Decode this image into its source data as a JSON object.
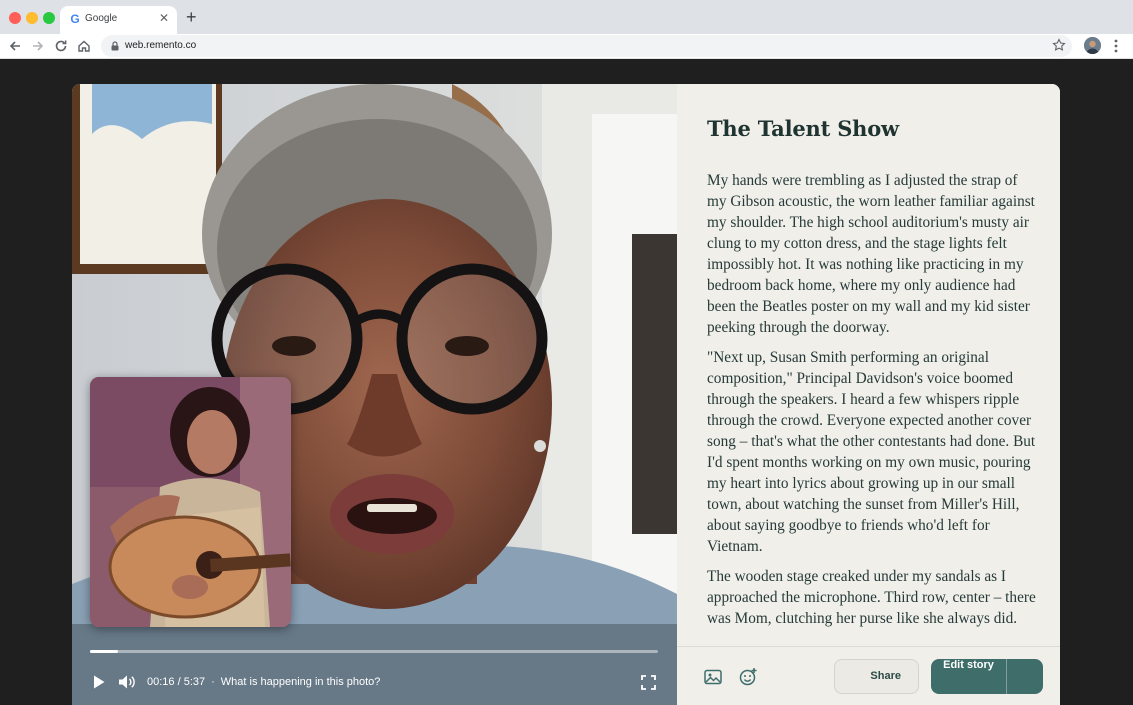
{
  "browser": {
    "tab_title": "Google",
    "tab_favicon": "G",
    "url": "web.remento.co",
    "icons": [
      "back-icon",
      "forward-icon",
      "reload-icon",
      "home-icon",
      "lock-icon",
      "bookmark-star-icon",
      "profile-avatar",
      "menu-kebab-icon"
    ]
  },
  "player": {
    "current_time": "00:16",
    "duration": "5:37",
    "time_display": "00:16 / 5:37",
    "separator": "·",
    "prompt": "What is happening in this photo?",
    "progress": 0.05,
    "icons": [
      "play-icon",
      "volume-icon",
      "fullscreen-icon"
    ]
  },
  "story": {
    "title": "The Talent Show",
    "paragraphs": [
      "My hands were trembling as I adjusted the strap of my Gibson acoustic, the worn leather familiar against my shoulder. The high school auditorium's musty air clung to my cotton dress, and the stage lights felt impossibly hot. It was nothing like practicing in my bedroom back home, where my only audience had been the Beatles poster on my wall and my kid sister peeking through the doorway.",
      "\"Next up, Susan Smith performing an original composition,\" Principal Davidson's voice boomed through the speakers. I heard a few whispers ripple through the crowd. Everyone expected another cover song – that's what the other contestants had done. But I'd spent months working on my own music, pouring my heart into lyrics about growing up in our small town, about watching the sunset from Miller's Hill, about saying goodbye to friends who'd left for Vietnam.",
      "The wooden stage creaked under my sandals as I approached the microphone. Third row, center – there was Mom, clutching her purse like she always did."
    ]
  },
  "footer": {
    "share_label": "Share",
    "edit_label": "Edit story",
    "icons": [
      "image-icon",
      "emoji-add-icon",
      "chevron-down-icon"
    ]
  },
  "colors": {
    "accent": "#3f6e6a",
    "panel_bg": "#f0efea",
    "text": "#263a38"
  }
}
